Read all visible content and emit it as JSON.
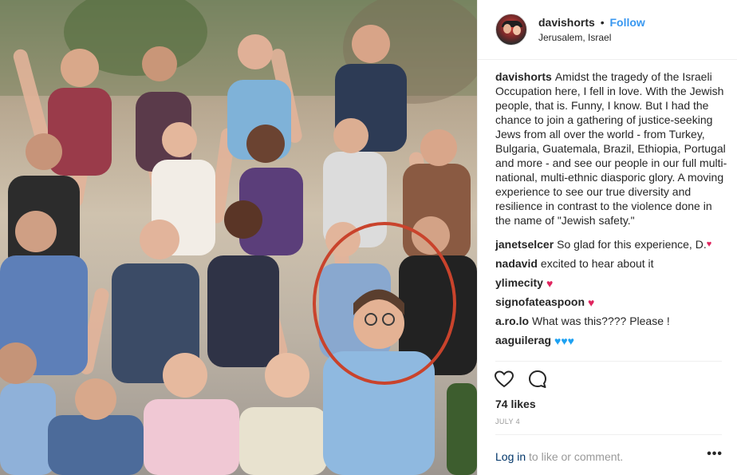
{
  "post": {
    "photo_alt_icon": "group-photo",
    "highlight_color": "#c9432c"
  },
  "header": {
    "username": "davishorts",
    "separator": "•",
    "follow_label": "Follow",
    "location": "Jerusalem, Israel"
  },
  "caption": {
    "username": "davishorts",
    "text": "Amidst the tragedy of the Israeli Occupation here, I fell in love. With the Jewish people, that is. Funny, I know. But I had the chance to join a gathering of justice-seeking Jews from all over the world - from Turkey, Bulgaria, Guatemala, Brazil, Ethiopia, Portugal and more - and see our people in our full multi-national, multi-ethnic diasporic glory. A moving experience to see our true diversity and resilience in contrast to the violence done in the name of \"Jewish safety.\""
  },
  "comments": [
    {
      "username": "janetselcer",
      "text": "So glad for this experience, D.",
      "hearts": "♥",
      "heart_color": "red"
    },
    {
      "username": "nadavid",
      "text": "excited to hear about it",
      "hearts": "",
      "heart_color": ""
    },
    {
      "username": "ylimecity",
      "text": "",
      "hearts": "♥",
      "heart_color": "red"
    },
    {
      "username": "signofateaspoon",
      "text": "",
      "hearts": "♥",
      "heart_color": "red"
    },
    {
      "username": "a.ro.lo",
      "text": "What was this???? Please !",
      "hearts": "",
      "heart_color": ""
    },
    {
      "username": "aaguilerag",
      "text": "",
      "hearts": "♥♥♥",
      "heart_color": "blue"
    }
  ],
  "actions": {
    "like_icon": "heart-outline-icon",
    "comment_icon": "speech-bubble-icon"
  },
  "likes": "74 likes",
  "date": "JULY 4",
  "footer": {
    "login_link": "Log in",
    "login_text": "to like or comment.",
    "more_icon": "•••"
  }
}
